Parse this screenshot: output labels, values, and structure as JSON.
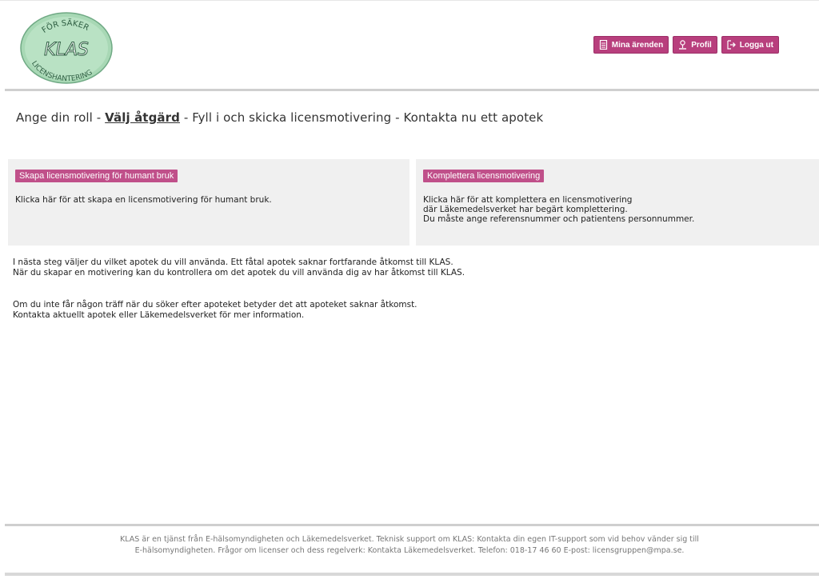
{
  "header": {
    "logo": {
      "top_text": "FÖR SÄKER",
      "main_text": "KLAS",
      "bottom_text": "LICENSHANTERING"
    },
    "buttons": [
      {
        "label": "Mina ärenden",
        "icon": "document-icon"
      },
      {
        "label": "Profil",
        "icon": "person-icon"
      },
      {
        "label": "Logga ut",
        "icon": "logout-icon"
      }
    ]
  },
  "breadcrumb": {
    "step1": "Ange din roll",
    "sep1": " - ",
    "step2": "Välj åtgärd",
    "sep2": " - ",
    "step3": "Fyll i och skicka licensmotivering",
    "sep3": " - ",
    "step4": "Kontakta nu ett apotek"
  },
  "cards": {
    "left": {
      "title": "Skapa licensmotivering för humant bruk",
      "line1": "Klicka här för att skapa en licensmotivering för humant bruk."
    },
    "right": {
      "title": "Komplettera licensmotivering",
      "line1": "Klicka här för att komplettera en licensmotivering",
      "line2": "där Läkemedelsverket har begärt komplettering.",
      "line3": "Du måste ange referensnummer och patientens personnummer."
    }
  },
  "info": {
    "p1_line1": "I nästa steg väljer du vilket apotek du vill använda. Ett fåtal apotek saknar fortfarande åtkomst till KLAS.",
    "p1_line2": "När du skapar en motivering kan du kontrollera om det apotek du vill använda dig av har åtkomst till KLAS.",
    "p2_line1": "Om du inte får någon träff när du söker efter apoteket betyder det att apoteket saknar åtkomst.",
    "p2_line2": "Kontakta aktuellt apotek eller Läkemedelsverket för mer information."
  },
  "footer": {
    "line1": "KLAS är en tjänst från E-hälsomyndigheten och Läkemedelsverket. Teknisk support om KLAS: Kontakta din egen IT-support som vid behov vänder sig till",
    "line2": "E-hälsomyndigheten. Frågor om licenser och dess regelverk: Kontakta Läkemedelsverket. Telefon: 018-17 46 60 E-post: licensgruppen@mpa.se."
  },
  "colors": {
    "accent": "#b83f7d",
    "card_bg": "#f0f0f0",
    "logo_green": "#a8d8b5"
  }
}
